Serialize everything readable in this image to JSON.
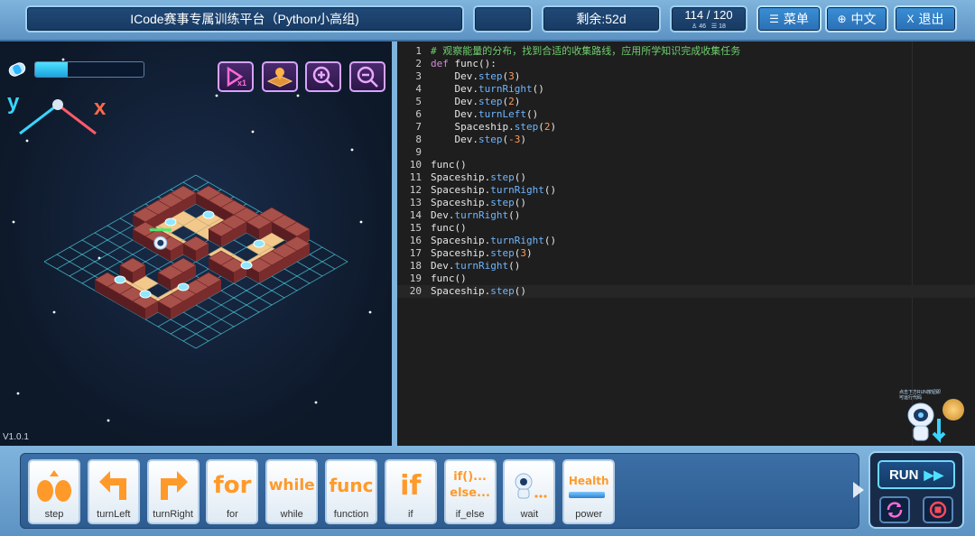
{
  "topbar": {
    "title": "ICode赛事专属训练平台（Python小高组)",
    "time_left": "剩余:52d",
    "count": "114 / 120",
    "count_sub_a": "46",
    "count_sub_b": "18",
    "menu": "菜单",
    "lang": "中文",
    "exit": "退出"
  },
  "game": {
    "energy_level": 0.3,
    "axis_y": "y",
    "axis_x": "x",
    "version": "V1.0.1",
    "tools": [
      "play-speed-icon",
      "map-icon",
      "zoom-in-icon",
      "zoom-out-icon"
    ],
    "speed_label": "x1"
  },
  "editor": {
    "current_line": 20,
    "lines": [
      {
        "n": "1",
        "tokens": [
          {
            "t": "# 观察能量的分布，找到合适的收集路线，应用所学知识完成收集任务",
            "c": "cm"
          }
        ]
      },
      {
        "n": "2",
        "tokens": [
          {
            "t": "def",
            "c": "kw"
          },
          {
            "t": " func():",
            "c": ""
          }
        ]
      },
      {
        "n": "3",
        "tokens": [
          {
            "t": "    Dev.",
            "c": ""
          },
          {
            "t": "step",
            "c": "fn"
          },
          {
            "t": "(",
            "c": ""
          },
          {
            "t": "3",
            "c": "num"
          },
          {
            "t": ")",
            "c": ""
          }
        ]
      },
      {
        "n": "4",
        "tokens": [
          {
            "t": "    Dev.",
            "c": ""
          },
          {
            "t": "turnRight",
            "c": "fn"
          },
          {
            "t": "()",
            "c": ""
          }
        ]
      },
      {
        "n": "5",
        "tokens": [
          {
            "t": "    Dev.",
            "c": ""
          },
          {
            "t": "step",
            "c": "fn"
          },
          {
            "t": "(",
            "c": ""
          },
          {
            "t": "2",
            "c": "num"
          },
          {
            "t": ")",
            "c": ""
          }
        ]
      },
      {
        "n": "6",
        "tokens": [
          {
            "t": "    Dev.",
            "c": ""
          },
          {
            "t": "turnLeft",
            "c": "fn"
          },
          {
            "t": "()",
            "c": ""
          }
        ]
      },
      {
        "n": "7",
        "tokens": [
          {
            "t": "    Spaceship.",
            "c": ""
          },
          {
            "t": "step",
            "c": "fn"
          },
          {
            "t": "(",
            "c": ""
          },
          {
            "t": "2",
            "c": "num"
          },
          {
            "t": ")",
            "c": ""
          }
        ]
      },
      {
        "n": "8",
        "tokens": [
          {
            "t": "    Dev.",
            "c": ""
          },
          {
            "t": "step",
            "c": "fn"
          },
          {
            "t": "(",
            "c": ""
          },
          {
            "t": "-3",
            "c": "num"
          },
          {
            "t": ")",
            "c": ""
          }
        ]
      },
      {
        "n": "9",
        "tokens": []
      },
      {
        "n": "10",
        "tokens": [
          {
            "t": "func()",
            "c": ""
          }
        ]
      },
      {
        "n": "11",
        "tokens": [
          {
            "t": "Spaceship.",
            "c": ""
          },
          {
            "t": "step",
            "c": "fn"
          },
          {
            "t": "()",
            "c": ""
          }
        ]
      },
      {
        "n": "12",
        "tokens": [
          {
            "t": "Spaceship.",
            "c": ""
          },
          {
            "t": "turnRight",
            "c": "fn"
          },
          {
            "t": "()",
            "c": ""
          }
        ]
      },
      {
        "n": "13",
        "tokens": [
          {
            "t": "Spaceship.",
            "c": ""
          },
          {
            "t": "step",
            "c": "fn"
          },
          {
            "t": "()",
            "c": ""
          }
        ]
      },
      {
        "n": "14",
        "tokens": [
          {
            "t": "Dev.",
            "c": ""
          },
          {
            "t": "turnRight",
            "c": "fn"
          },
          {
            "t": "()",
            "c": ""
          }
        ]
      },
      {
        "n": "15",
        "tokens": [
          {
            "t": "func()",
            "c": ""
          }
        ]
      },
      {
        "n": "16",
        "tokens": [
          {
            "t": "Spaceship.",
            "c": ""
          },
          {
            "t": "turnRight",
            "c": "fn"
          },
          {
            "t": "()",
            "c": ""
          }
        ]
      },
      {
        "n": "17",
        "tokens": [
          {
            "t": "Spaceship.",
            "c": ""
          },
          {
            "t": "step",
            "c": "fn"
          },
          {
            "t": "(",
            "c": ""
          },
          {
            "t": "3",
            "c": "num"
          },
          {
            "t": ")",
            "c": ""
          }
        ]
      },
      {
        "n": "18",
        "tokens": [
          {
            "t": "Dev.",
            "c": ""
          },
          {
            "t": "turnRight",
            "c": "fn"
          },
          {
            "t": "()",
            "c": ""
          }
        ]
      },
      {
        "n": "19",
        "tokens": [
          {
            "t": "func()",
            "c": ""
          }
        ]
      },
      {
        "n": "20",
        "tokens": [
          {
            "t": "Spaceship.",
            "c": ""
          },
          {
            "t": "step",
            "c": "fn"
          },
          {
            "t": "()",
            "c": ""
          }
        ]
      }
    ]
  },
  "blocks": [
    {
      "label": "step",
      "word": "",
      "icon": "step-icon"
    },
    {
      "label": "turnLeft",
      "word": "",
      "icon": "turn-left-icon"
    },
    {
      "label": "turnRight",
      "word": "",
      "icon": "turn-right-icon"
    },
    {
      "label": "for",
      "word": "for",
      "icon": ""
    },
    {
      "label": "while",
      "word": "while",
      "icon": ""
    },
    {
      "label": "function",
      "word": "func",
      "icon": ""
    },
    {
      "label": "if",
      "word": "if",
      "icon": ""
    },
    {
      "label": "if_else",
      "word": "if()...\nelse...",
      "icon": ""
    },
    {
      "label": "wait",
      "word": "",
      "icon": "wait-icon"
    },
    {
      "label": "power",
      "word": "Health",
      "icon": ""
    }
  ],
  "run": {
    "label": "RUN"
  },
  "colors": {
    "accent": "#9fd0f2",
    "keyword": "#d28cd8",
    "function": "#6fb6ff",
    "number": "#ff9a5a",
    "comment": "#6fd06f",
    "orange": "#ff9a2a"
  }
}
